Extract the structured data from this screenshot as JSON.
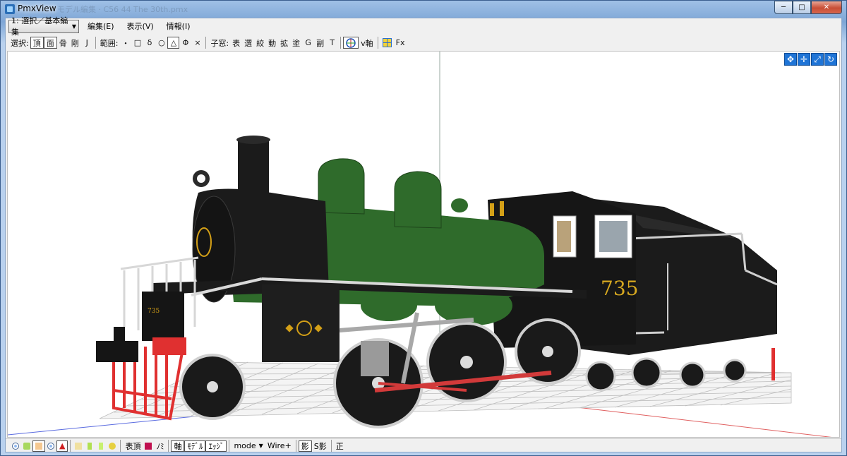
{
  "window": {
    "title": "PmxView",
    "title_faint": "モデル編集 · C56 44 The 30th.pmx",
    "buttons": [
      "─",
      "□",
      "✕"
    ]
  },
  "toolbar1": {
    "mode_select": "1: 選択／基本編集",
    "menus": [
      "編集(E)",
      "表示(V)",
      "情報(I)"
    ]
  },
  "toolbar2": {
    "select_label": "選択:",
    "select_items": [
      "頂",
      "面",
      "骨",
      "剛",
      "J"
    ],
    "range_label": "範囲:",
    "range_items": [
      "・",
      "□",
      "δ",
      "○",
      "△",
      "Φ",
      "×"
    ],
    "child_label": "子窓:",
    "child_items": [
      "表",
      "選",
      "絞",
      "動",
      "拡",
      "塗",
      "G",
      "副",
      "T"
    ],
    "axis_label": "v軸",
    "fx_label": "Fx"
  },
  "model": {
    "number": "735",
    "number_small": "735",
    "colors": {
      "boiler": "#2f6b2b",
      "body": "#1b1b1b",
      "rods": "#d23a3a",
      "pilot": "#e03030",
      "gold": "#d4a017"
    }
  },
  "statusbar": {
    "items": [
      "表頂",
      "ﾉﾐ",
      "軸",
      "ﾓﾃﾞﾙ",
      "ｴｯｼﾞ",
      "mode",
      "Wire+",
      "影",
      "S影",
      "正"
    ]
  }
}
